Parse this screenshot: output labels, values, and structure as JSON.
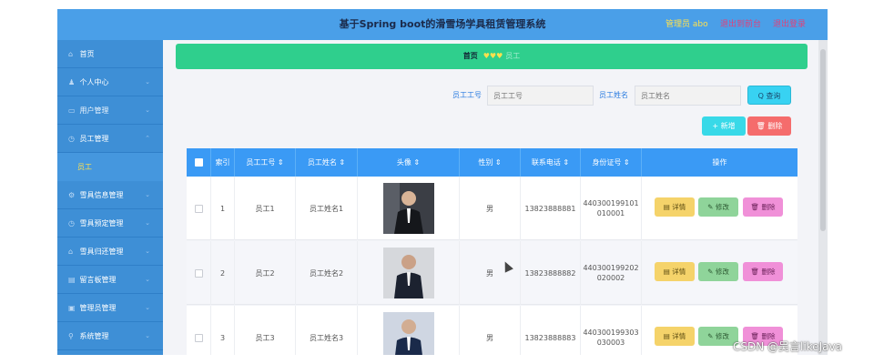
{
  "header": {
    "title": "基于Spring boot的滑雪场学具租赁管理系统",
    "admin_label": "管理员 abo",
    "exit_backend": "退出到前台",
    "logout": "退出登录"
  },
  "sidebar": {
    "items": [
      {
        "label": "首页",
        "icon": "home-icon",
        "glyph": "⌂"
      },
      {
        "label": "个人中心",
        "icon": "user-icon",
        "glyph": "👤"
      },
      {
        "label": "用户管理",
        "icon": "chat-icon",
        "glyph": "▭"
      },
      {
        "label": "员工管理",
        "icon": "clock-icon",
        "glyph": "◷"
      },
      {
        "label": "员工",
        "icon": "",
        "glyph": ""
      },
      {
        "label": "雪具信息管理",
        "icon": "gear-icon",
        "glyph": "⚙"
      },
      {
        "label": "雪具预定管理",
        "icon": "clock-icon",
        "glyph": "◷"
      },
      {
        "label": "雪具归还管理",
        "icon": "home-icon",
        "glyph": "⌂"
      },
      {
        "label": "留言板管理",
        "icon": "board-icon",
        "glyph": "▤"
      },
      {
        "label": "管理员管理",
        "icon": "lock-icon",
        "glyph": "▣"
      },
      {
        "label": "系统管理",
        "icon": "pin-icon",
        "glyph": "⚲"
      }
    ]
  },
  "breadcrumb": {
    "home": "首页",
    "hearts": "♥♥♥",
    "current": "员工"
  },
  "search": {
    "emp_no_label": "员工工号",
    "emp_no_placeholder": "员工工号",
    "emp_name_label": "员工姓名",
    "emp_name_placeholder": "员工姓名",
    "query_button": "Q 查询"
  },
  "toolbar": {
    "add": "+ 新增",
    "delete": "🗑 删除"
  },
  "table": {
    "columns": [
      "",
      "索引",
      "员工工号 ⇕",
      "员工姓名 ⇕",
      "头像 ⇕",
      "性别 ⇕",
      "联系电话 ⇕",
      "身份证号 ⇕",
      "操作"
    ],
    "rows": [
      {
        "index": "1",
        "emp_no": "员工1",
        "name": "员工姓名1",
        "gender": "男",
        "phone": "13823888881",
        "id_line1": "440300199101",
        "id_line2": "010001"
      },
      {
        "index": "2",
        "emp_no": "员工2",
        "name": "员工姓名2",
        "gender": "男",
        "phone": "13823888882",
        "id_line1": "440300199202",
        "id_line2": "020002"
      },
      {
        "index": "3",
        "emp_no": "员工3",
        "name": "员工姓名3",
        "gender": "男",
        "phone": "13823888883",
        "id_line1": "440300199303",
        "id_line2": "030003"
      }
    ],
    "actions": {
      "detail": "▤ 详情",
      "edit": "✎ 修改",
      "delete": "🗑 删除"
    }
  },
  "watermark": "CSDN @吴言likeJava"
}
